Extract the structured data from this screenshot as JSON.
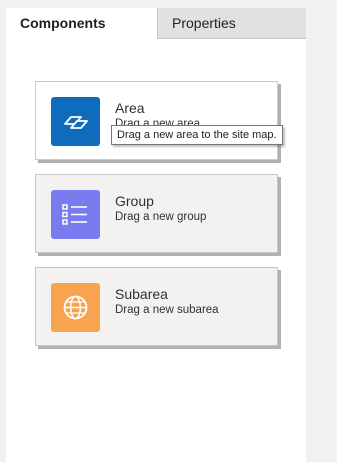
{
  "tabs": {
    "components": "Components",
    "properties": "Properties"
  },
  "components": [
    {
      "title": "Area",
      "description": "Drag a new area",
      "icon": "area-icon",
      "tile_color": "#0f6cbd"
    },
    {
      "title": "Group",
      "description": "Drag a new group",
      "icon": "group-list-icon",
      "tile_color": "#7b7bf0"
    },
    {
      "title": "Subarea",
      "description": "Drag a new subarea",
      "icon": "globe-icon",
      "tile_color": "#f7a450"
    }
  ],
  "tooltip": {
    "text": "Drag a new area to the site map."
  }
}
